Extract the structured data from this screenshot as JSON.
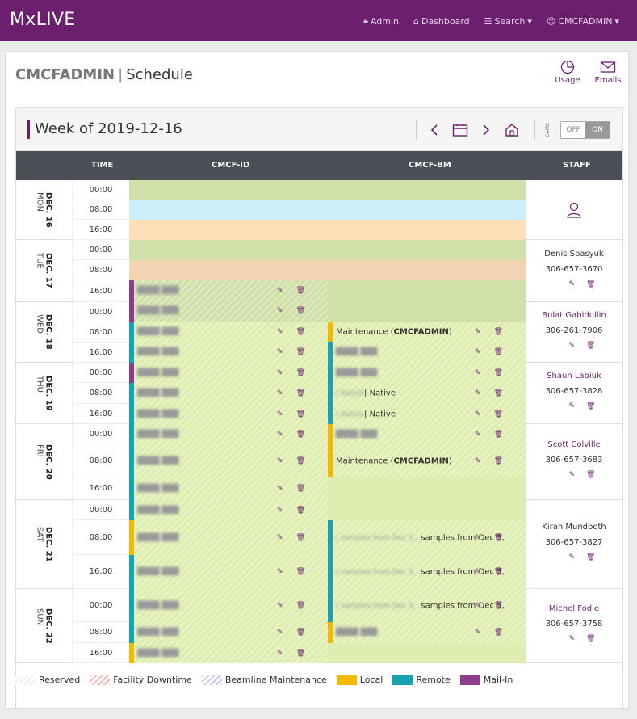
{
  "nav": {
    "brand": "MxLIVE",
    "admin": "Admin",
    "dashboard": "Dashboard",
    "search": "Search",
    "user": "CMCFADMIN"
  },
  "header": {
    "user": "CMCFADMIN",
    "page_title": "Schedule",
    "usage_label": "Usage",
    "emails_label": "Emails"
  },
  "toolbar": {
    "week_title": "Week of 2019-12-16",
    "camc_label": "CAMC",
    "toggle_off": "OFF",
    "toggle_on": "ON"
  },
  "table": {
    "headers": {
      "time": "TIME",
      "cmcf_id": "CMCF-ID",
      "cmcf_bm": "CMCF-BM",
      "staff": "STAFF"
    }
  },
  "days": [
    {
      "month": "DEC.",
      "date": "16",
      "weekday": "MON",
      "times": [
        "00:00",
        "08:00",
        "16:00"
      ],
      "staff_name": "",
      "staff_phone": ""
    },
    {
      "month": "DEC.",
      "date": "17",
      "weekday": "TUE",
      "times": [
        "00:00",
        "08:00",
        "16:00"
      ],
      "staff_name": "Denis Spasyuk",
      "staff_phone": "306-657-3670"
    },
    {
      "month": "DEC.",
      "date": "18",
      "weekday": "WED",
      "times": [
        "00:00",
        "08:00",
        "16:00"
      ],
      "staff_name": "Bulat Gabidullin",
      "staff_phone": "306-261-7906"
    },
    {
      "month": "DEC.",
      "date": "19",
      "weekday": "THU",
      "times": [
        "00:00",
        "08:00",
        "16:00"
      ],
      "staff_name": "Shaun Labiuk",
      "staff_phone": "306-657-3828"
    },
    {
      "month": "DEC.",
      "date": "20",
      "weekday": "FRI",
      "times": [
        "00:00",
        "08:00",
        "16:00"
      ],
      "staff_name": "Scott Colville",
      "staff_phone": "306-657-3683"
    },
    {
      "month": "DEC.",
      "date": "21",
      "weekday": "SAT",
      "times": [
        "00:00",
        "08:00",
        "16:00"
      ],
      "staff_name": "Kiran Mundboth",
      "staff_phone": "306-657-3827"
    },
    {
      "month": "DEC.",
      "date": "22",
      "weekday": "SUN",
      "times": [
        "00:00",
        "08:00",
        "16:00"
      ],
      "staff_name": "Michel Fodje",
      "staff_phone": "306-657-3758"
    }
  ],
  "bookings": {
    "maint_prefix": "Maintenance (",
    "maint_user": "CMCFADMIN",
    "maint_suffix": ")",
    "native": "| Native",
    "samples": "| samples from Dec 5,"
  },
  "colors": {
    "local": "#f5b800",
    "remote": "#17a2b8",
    "mailin": "#8e3b8e",
    "brand": "#6b1f6e"
  },
  "legend": [
    {
      "label": "Reserved"
    },
    {
      "label": "Facility Downtime"
    },
    {
      "label": "Beamline Maintenance"
    },
    {
      "label": "Local"
    },
    {
      "label": "Remote"
    },
    {
      "label": "Mail-In"
    }
  ]
}
